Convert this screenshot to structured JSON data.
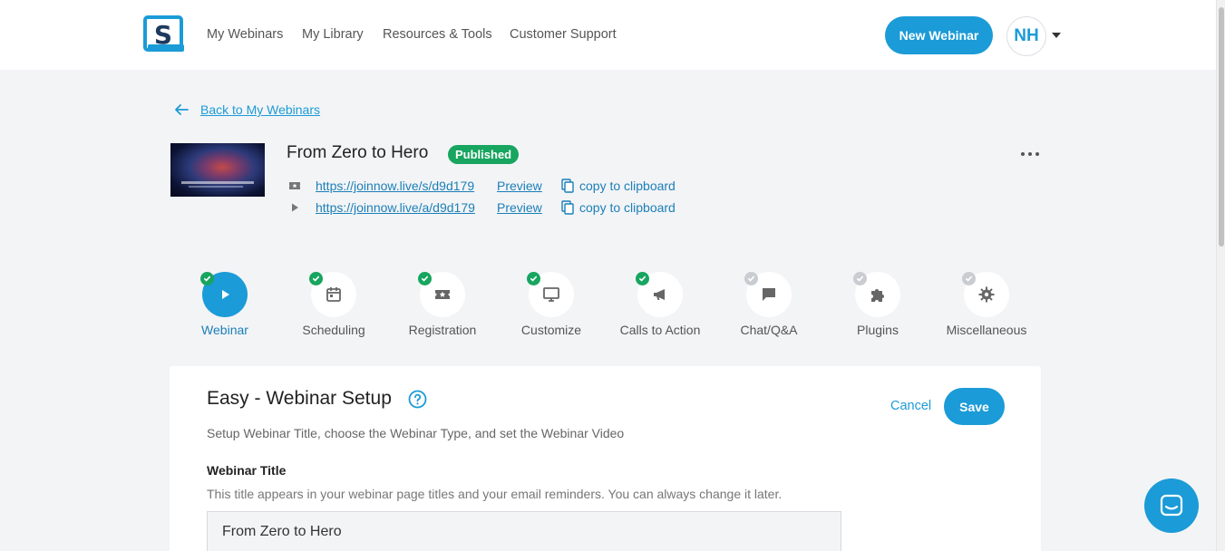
{
  "nav": {
    "logo_letter": "S",
    "links": [
      "My Webinars",
      "My Library",
      "Resources & Tools",
      "Customer Support"
    ],
    "new_webinar_label": "New Webinar",
    "avatar_initials": "NH"
  },
  "back_label": "Back to My Webinars",
  "webinar": {
    "title": "From Zero to Hero",
    "status": "Published",
    "registration_url": "https://joinnow.live/s/d9d179",
    "attendee_url": "https://joinnow.live/a/d9d179",
    "preview_label": "Preview",
    "copy_label": "copy to clipboard"
  },
  "steps": [
    {
      "label": "Webinar",
      "icon": "play-icon",
      "complete": true,
      "active": true
    },
    {
      "label": "Scheduling",
      "icon": "calendar-icon",
      "complete": true,
      "active": false
    },
    {
      "label": "Registration",
      "icon": "ticket-icon",
      "complete": true,
      "active": false
    },
    {
      "label": "Customize",
      "icon": "monitor-icon",
      "complete": true,
      "active": false
    },
    {
      "label": "Calls to Action",
      "icon": "megaphone-icon",
      "complete": true,
      "active": false
    },
    {
      "label": "Chat/Q&A",
      "icon": "chat-icon",
      "complete": false,
      "active": false
    },
    {
      "label": "Plugins",
      "icon": "puzzle-icon",
      "complete": false,
      "active": false
    },
    {
      "label": "Miscellaneous",
      "icon": "gear-icon",
      "complete": false,
      "active": false
    }
  ],
  "setup": {
    "title": "Easy - Webinar Setup",
    "subtitle": "Setup Webinar Title, choose the Webinar Type, and set the Webinar Video",
    "cancel_label": "Cancel",
    "save_label": "Save",
    "field_label": "Webinar Title",
    "field_help": "This title appears in your webinar page titles and your email reminders. You can always change it later.",
    "field_value": "From Zero to Hero"
  },
  "colors": {
    "accent": "#1b9bd7",
    "success": "#17a55f",
    "pending": "#c9ccd1",
    "background": "#f3f4f6"
  }
}
